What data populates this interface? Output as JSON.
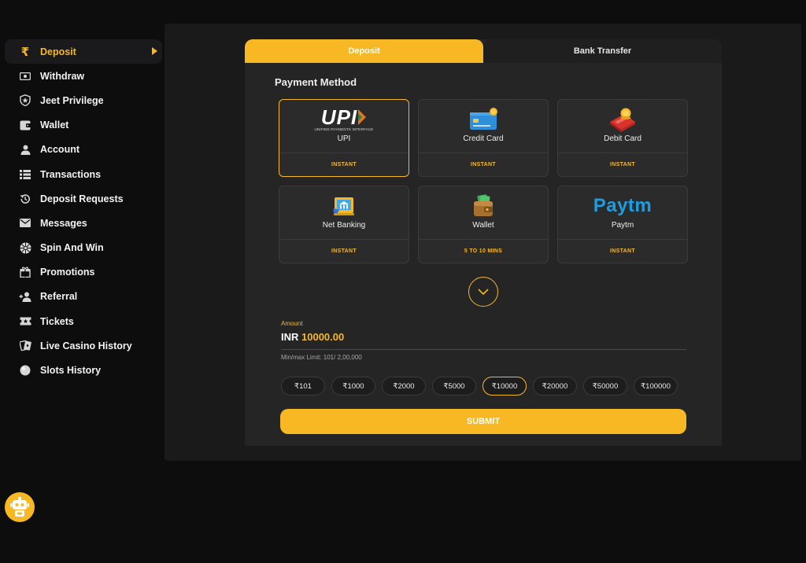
{
  "sidebar": {
    "items": [
      {
        "label": "Deposit",
        "icon": "rupee-icon"
      },
      {
        "label": "Withdraw",
        "icon": "cash-icon"
      },
      {
        "label": "Jeet Privilege",
        "icon": "shield-icon"
      },
      {
        "label": "Wallet",
        "icon": "wallet-icon"
      },
      {
        "label": "Account",
        "icon": "person-icon"
      },
      {
        "label": "Transactions",
        "icon": "list-icon"
      },
      {
        "label": "Deposit Requests",
        "icon": "history-icon"
      },
      {
        "label": "Messages",
        "icon": "mail-icon"
      },
      {
        "label": "Spin And Win",
        "icon": "spin-icon"
      },
      {
        "label": "Promotions",
        "icon": "gift-icon"
      },
      {
        "label": "Referral",
        "icon": "add-person-icon"
      },
      {
        "label": "Tickets",
        "icon": "ticket-icon"
      },
      {
        "label": "Live Casino History",
        "icon": "cards-icon"
      },
      {
        "label": "Slots History",
        "icon": "slots-icon"
      }
    ]
  },
  "tabs": {
    "deposit": "Deposit",
    "bank_transfer": "Bank Transfer"
  },
  "payment": {
    "title": "Payment Method",
    "upi_logo": "UPI",
    "upi_tagline": "UNIFIED PAYMENTS INTERFACE",
    "paytm_logo": "Paytm",
    "methods": [
      {
        "name": "UPI",
        "speed": "INSTANT"
      },
      {
        "name": "Credit Card",
        "speed": "INSTANT"
      },
      {
        "name": "Debit Card",
        "speed": "INSTANT"
      },
      {
        "name": "Net Banking",
        "speed": "INSTANT"
      },
      {
        "name": "Wallet",
        "speed": "5 TO 10 MINS"
      },
      {
        "name": "Paytm",
        "speed": "INSTANT"
      }
    ]
  },
  "amount": {
    "label": "Amount",
    "currency": "INR",
    "value": "10000.00",
    "limit": "Min/max Limit: 101/ 2,00,000"
  },
  "chips": [
    "₹101",
    "₹1000",
    "₹2000",
    "₹5000",
    "₹10000",
    "₹20000",
    "₹50000",
    "₹100000"
  ],
  "submit_label": "SUBMIT",
  "colors": {
    "accent": "#f7b824",
    "background": "#0d0d0e",
    "panel": "#252526"
  }
}
